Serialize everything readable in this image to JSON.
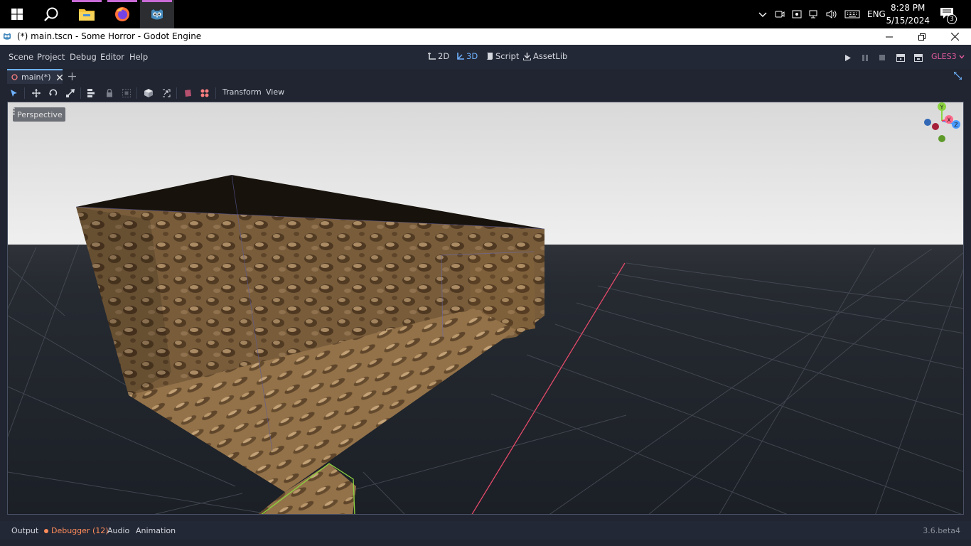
{
  "taskbar": {
    "apps": [
      {
        "name": "start",
        "icon": "windows-start-icon"
      },
      {
        "name": "search",
        "icon": "search-icon"
      },
      {
        "name": "file-explorer",
        "icon": "folder-icon"
      },
      {
        "name": "firefox",
        "icon": "firefox-icon"
      },
      {
        "name": "godot",
        "icon": "godot-icon"
      }
    ],
    "tray": {
      "language": "ENG",
      "time": "8:28 PM",
      "date": "5/15/2024",
      "notification_count": "3"
    }
  },
  "window": {
    "title": "(*) main.tscn - Some Horror - Godot Engine"
  },
  "menu": {
    "items": [
      "Scene",
      "Project",
      "Debug",
      "Editor",
      "Help"
    ]
  },
  "workspaces": [
    {
      "label": "2D",
      "active": false
    },
    {
      "label": "3D",
      "active": true
    },
    {
      "label": "Script",
      "active": false
    },
    {
      "label": "AssetLib",
      "active": false
    }
  ],
  "renderer": "GLES3",
  "tabs": [
    {
      "label": "main(*)"
    }
  ],
  "toolbar": {
    "transform_label": "Transform",
    "view_label": "View"
  },
  "viewport": {
    "perspective_label": "Perspective",
    "gizmo": {
      "y": "Y",
      "x": "X",
      "z": "Z"
    }
  },
  "bottom_panel": {
    "output": "Output",
    "debugger": "Debugger (12)",
    "audio": "Audio",
    "animation": "Animation",
    "version": "3.6.beta4"
  },
  "colors": {
    "accent": "#6fb2ff",
    "debugger_warning": "#ff8c5a",
    "renderer": "#e05a9e",
    "x_axis": "#ff3b5c",
    "y_axis": "#8bd43f",
    "z_axis": "#4a9bff"
  }
}
